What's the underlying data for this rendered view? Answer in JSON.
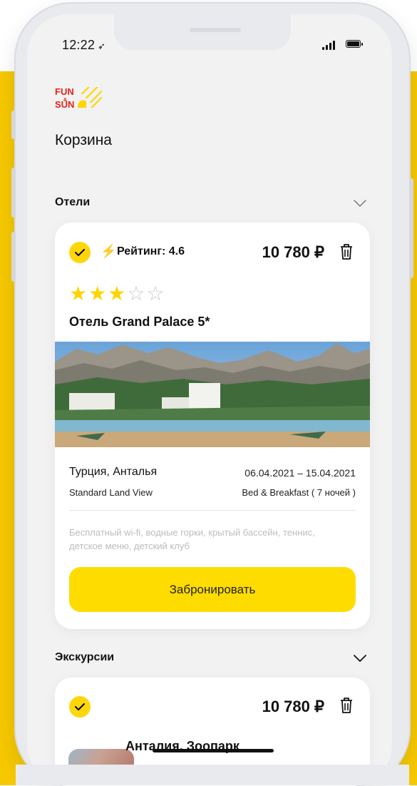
{
  "status": {
    "time": "12:22"
  },
  "brand": {
    "logo_line1": "FUN",
    "logo_amp": "&",
    "logo_line2": "SUN"
  },
  "page": {
    "title": "Корзина"
  },
  "sections": [
    {
      "label": "Отели"
    },
    {
      "label": "Экскурсии"
    }
  ],
  "hotel_card": {
    "selected": true,
    "rating_label": "Рейтинг: 4.6",
    "price": "10 780 ₽",
    "stars_filled": 3,
    "stars_total": 5,
    "name": "Отель Grand Palace 5*",
    "location": "Турция, Анталья",
    "dates": "06.04.2021 – 15.04.2021",
    "room_type": "Standard Land View",
    "board": "Bed & Breakfast ( 7 ночей )",
    "amenities": "Бесплатный wi-fi, водные горки, крытый бассейн, теннис, детское меню, детский клуб",
    "book_button": "Забронировать"
  },
  "excursion_card": {
    "selected": true,
    "price": "10 780 ₽",
    "title": "Анталия. Зоопарк"
  },
  "colors": {
    "accent_yellow": "#ffdc00",
    "background_yellow": "#f6c800",
    "star_yellow": "#ffd400",
    "screen_bg": "#f2f2f2"
  }
}
